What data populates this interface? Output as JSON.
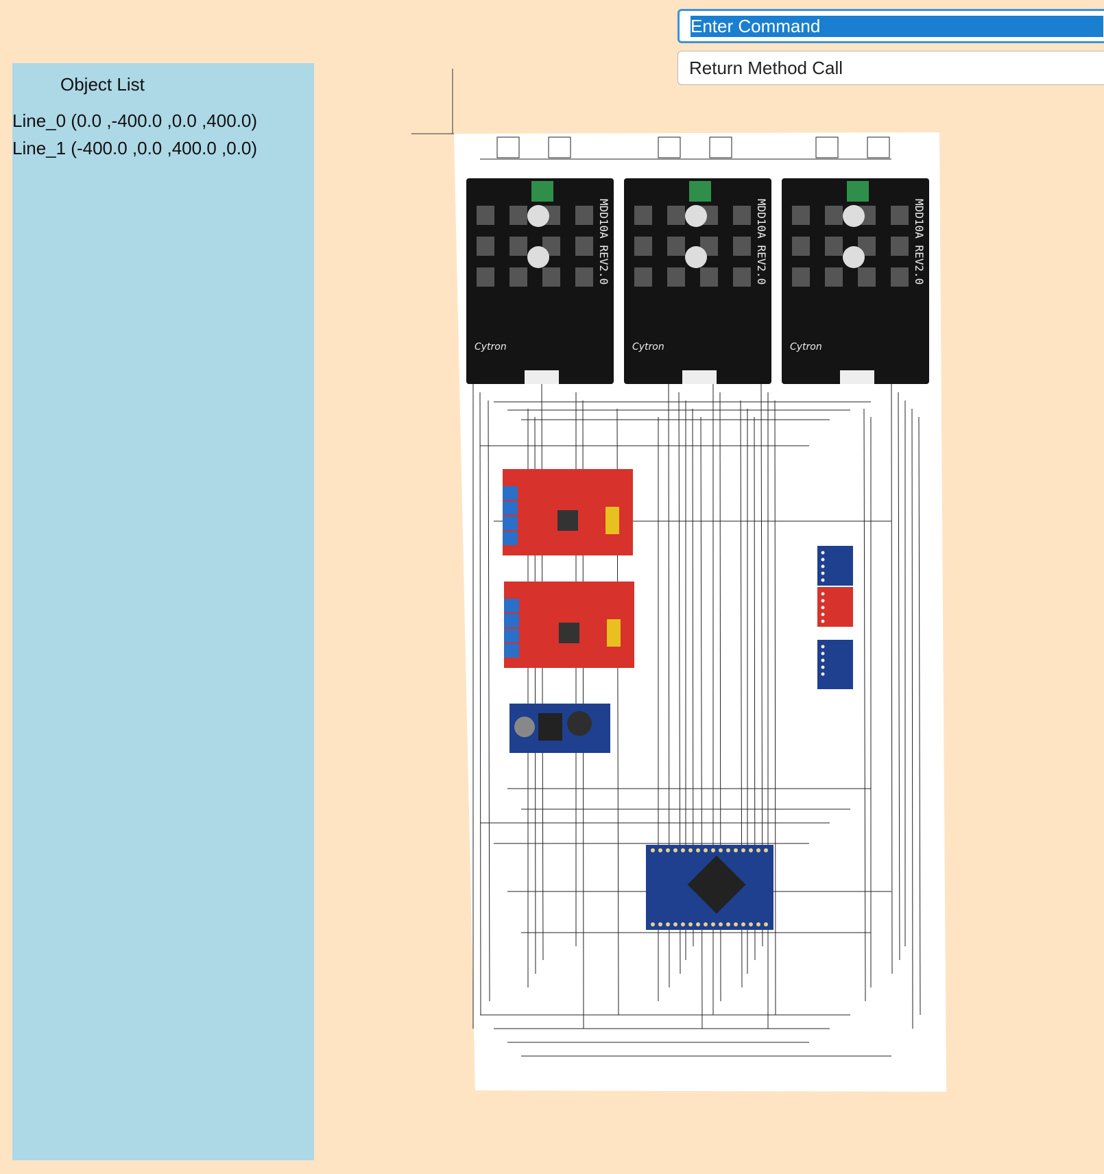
{
  "object_panel": {
    "title": "Object List",
    "items": [
      "Line_0 (0.0 ,-400.0 ,0.0 ,400.0)",
      "Line_1 (-400.0 ,0.0 ,400.0 ,0.0)"
    ]
  },
  "command": {
    "placeholder": "Enter Command",
    "return_label": "Return Method Call"
  },
  "canvas": {
    "background": "#ffffff",
    "modules": [
      {
        "name": "motor-driver-1",
        "kind": "motor-driver",
        "board_text": "MDD10A REV2.0",
        "logo": "Cytron"
      },
      {
        "name": "motor-driver-2",
        "kind": "motor-driver",
        "board_text": "MDD10A REV2.0",
        "logo": "Cytron"
      },
      {
        "name": "motor-driver-3",
        "kind": "motor-driver",
        "board_text": "MDD10A REV2.0",
        "logo": "Cytron"
      },
      {
        "name": "red-driver-1",
        "kind": "red-board"
      },
      {
        "name": "red-driver-2",
        "kind": "red-board"
      },
      {
        "name": "buck-converter",
        "kind": "buck"
      },
      {
        "name": "pro-mini",
        "kind": "arduino"
      },
      {
        "name": "imu-1",
        "kind": "sensor-blue"
      },
      {
        "name": "sensor-red",
        "kind": "sensor-red"
      },
      {
        "name": "imu-2",
        "kind": "sensor-blue"
      }
    ],
    "colors": {
      "driver": "#141414",
      "red_board": "#d7322b",
      "blue_board": "#1f3f8f",
      "wire": "#222222"
    }
  }
}
